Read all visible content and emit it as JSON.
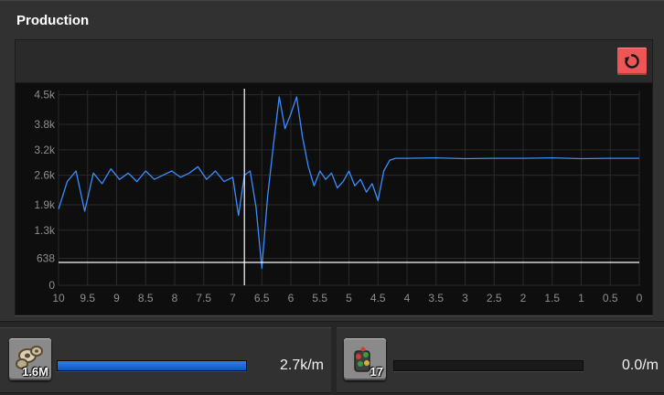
{
  "window": {
    "title": "Production"
  },
  "toolbar": {
    "reset_icon": "reset-icon"
  },
  "chart_data": {
    "type": "line",
    "title": "",
    "xlabel": "",
    "ylabel": "",
    "x_ticks": [
      "10",
      "9.5",
      "9",
      "8.5",
      "8",
      "7.5",
      "7",
      "6.5",
      "6",
      "5.5",
      "5",
      "4.5",
      "4",
      "3.5",
      "3",
      "2.5",
      "2",
      "1.5",
      "1",
      "0.5",
      "0"
    ],
    "y_ticks": [
      "0",
      "638",
      "1.3k",
      "1.9k",
      "2.6k",
      "3.2k",
      "3.8k",
      "4.5k"
    ],
    "xlim": [
      10,
      0
    ],
    "ylim": [
      0,
      4600
    ],
    "grid": true,
    "cursor_x": 6.8,
    "cursor_y": 540,
    "series": [
      {
        "color": "#3a8cff",
        "x": [
          10,
          9.85,
          9.7,
          9.55,
          9.4,
          9.25,
          9.1,
          8.95,
          8.8,
          8.65,
          8.5,
          8.35,
          8.2,
          8.05,
          7.9,
          7.75,
          7.6,
          7.45,
          7.3,
          7.15,
          7.0,
          6.9,
          6.8,
          6.7,
          6.6,
          6.5,
          6.4,
          6.3,
          6.2,
          6.1,
          6.0,
          5.9,
          5.8,
          5.7,
          5.6,
          5.5,
          5.4,
          5.3,
          5.2,
          5.1,
          5.0,
          4.9,
          4.8,
          4.7,
          4.6,
          4.5,
          4.4,
          4.3,
          4.2,
          4.0,
          3.5,
          3.0,
          2.5,
          2.0,
          1.5,
          1.0,
          0.5,
          0.0
        ],
        "y": [
          1800,
          2450,
          2700,
          1750,
          2650,
          2400,
          2750,
          2500,
          2650,
          2450,
          2700,
          2500,
          2600,
          2700,
          2550,
          2650,
          2800,
          2500,
          2700,
          2450,
          2550,
          1650,
          2600,
          2700,
          1850,
          400,
          2100,
          3300,
          4450,
          3700,
          4050,
          4450,
          3500,
          2800,
          2350,
          2700,
          2500,
          2650,
          2300,
          2450,
          2700,
          2350,
          2500,
          2200,
          2400,
          2000,
          2700,
          2950,
          3000,
          3000,
          3010,
          2990,
          3000,
          3000,
          3010,
          2990,
          3000,
          3000
        ]
      }
    ]
  },
  "footer": {
    "left": {
      "item_icon": "stone-ore-icon",
      "count": "1.6M",
      "fill_fraction": 1.0,
      "rate": "2.7k/m"
    },
    "right": {
      "item_icon": "circuit-item-icon",
      "count": "17",
      "fill_fraction": 0.0,
      "rate": "0.0/m"
    }
  }
}
